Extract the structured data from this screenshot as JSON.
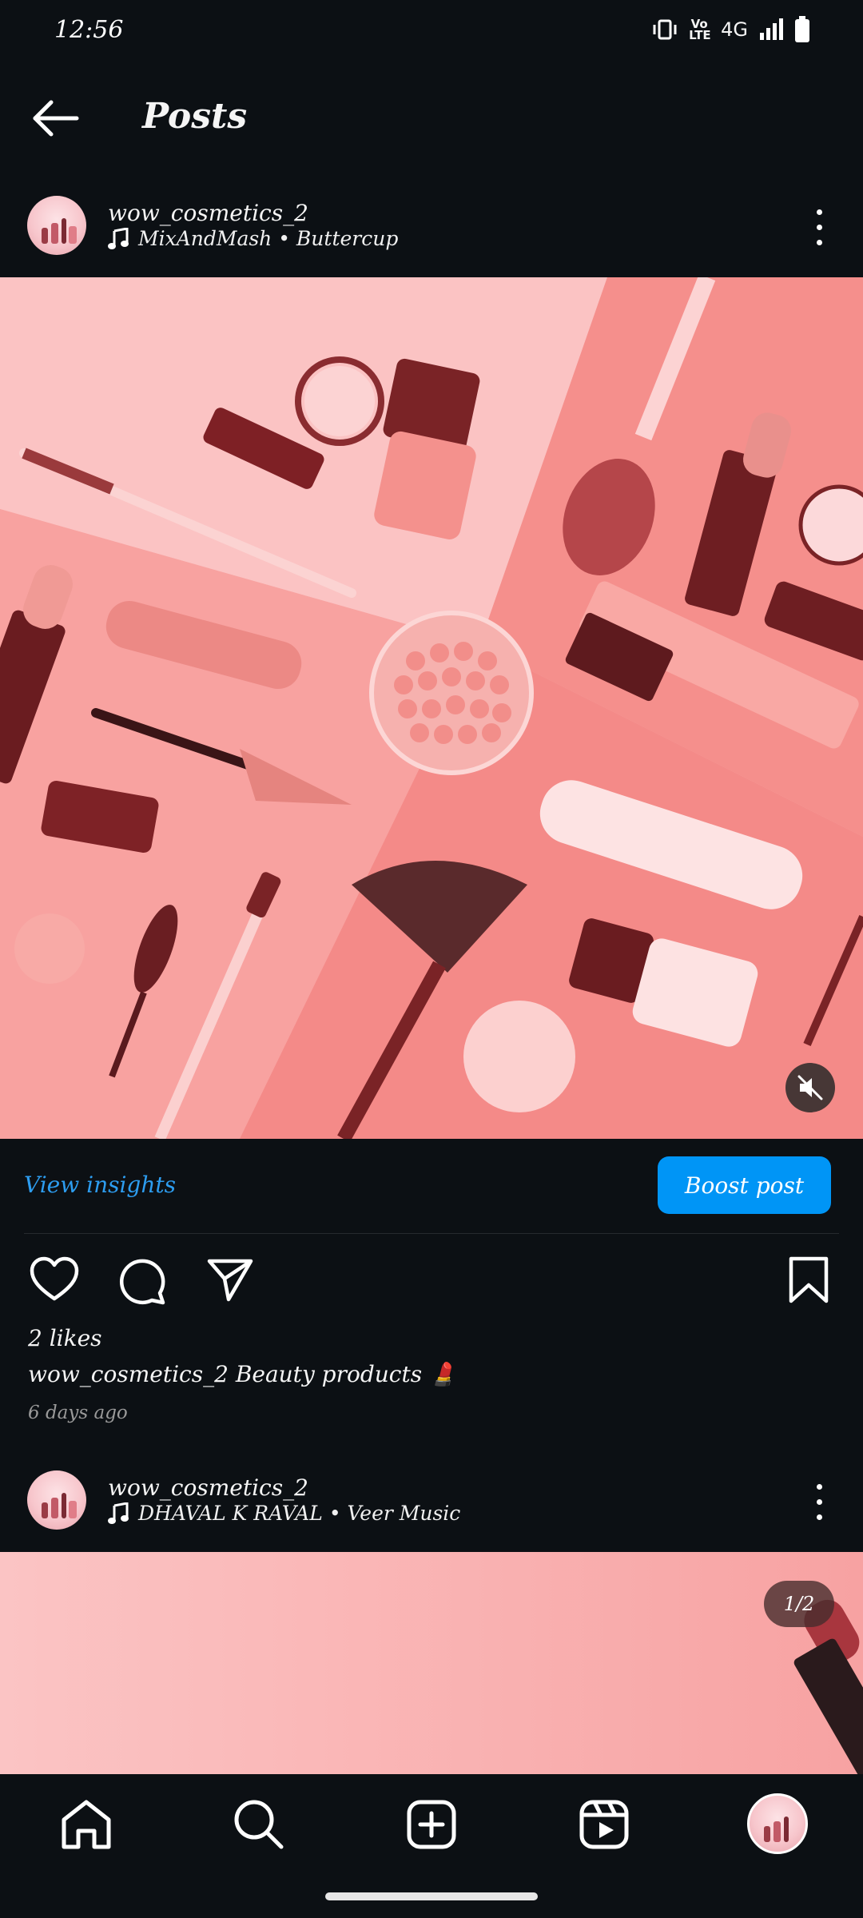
{
  "status_bar": {
    "time": "12:56",
    "network": "4G",
    "volte": "Vo LTE",
    "icons": [
      "vibrate-icon",
      "volte-icon",
      "signal-icon",
      "battery-icon"
    ]
  },
  "header": {
    "title": "Posts",
    "back_icon": "arrow-left-icon"
  },
  "posts": [
    {
      "username": "wow_cosmetics_2",
      "music": "MixAndMash • Buttercup",
      "view_insights": "View insights",
      "boost_label": "Boost post",
      "likes": "2 likes",
      "caption_user": "wow_cosmetics_2",
      "caption_text": "Beauty products 💄",
      "timestamp": "6 days ago"
    },
    {
      "username": "wow_cosmetics_2",
      "music": "DHAVAL K RAVAL • Veer Music",
      "carousel_counter": "1/2"
    }
  ],
  "bottom_nav": [
    "home-icon",
    "search-icon",
    "create-icon",
    "reels-icon",
    "profile-avatar"
  ],
  "colors": {
    "background": "#0c1014",
    "accent": "#0095f6",
    "link": "#2d9df0"
  }
}
